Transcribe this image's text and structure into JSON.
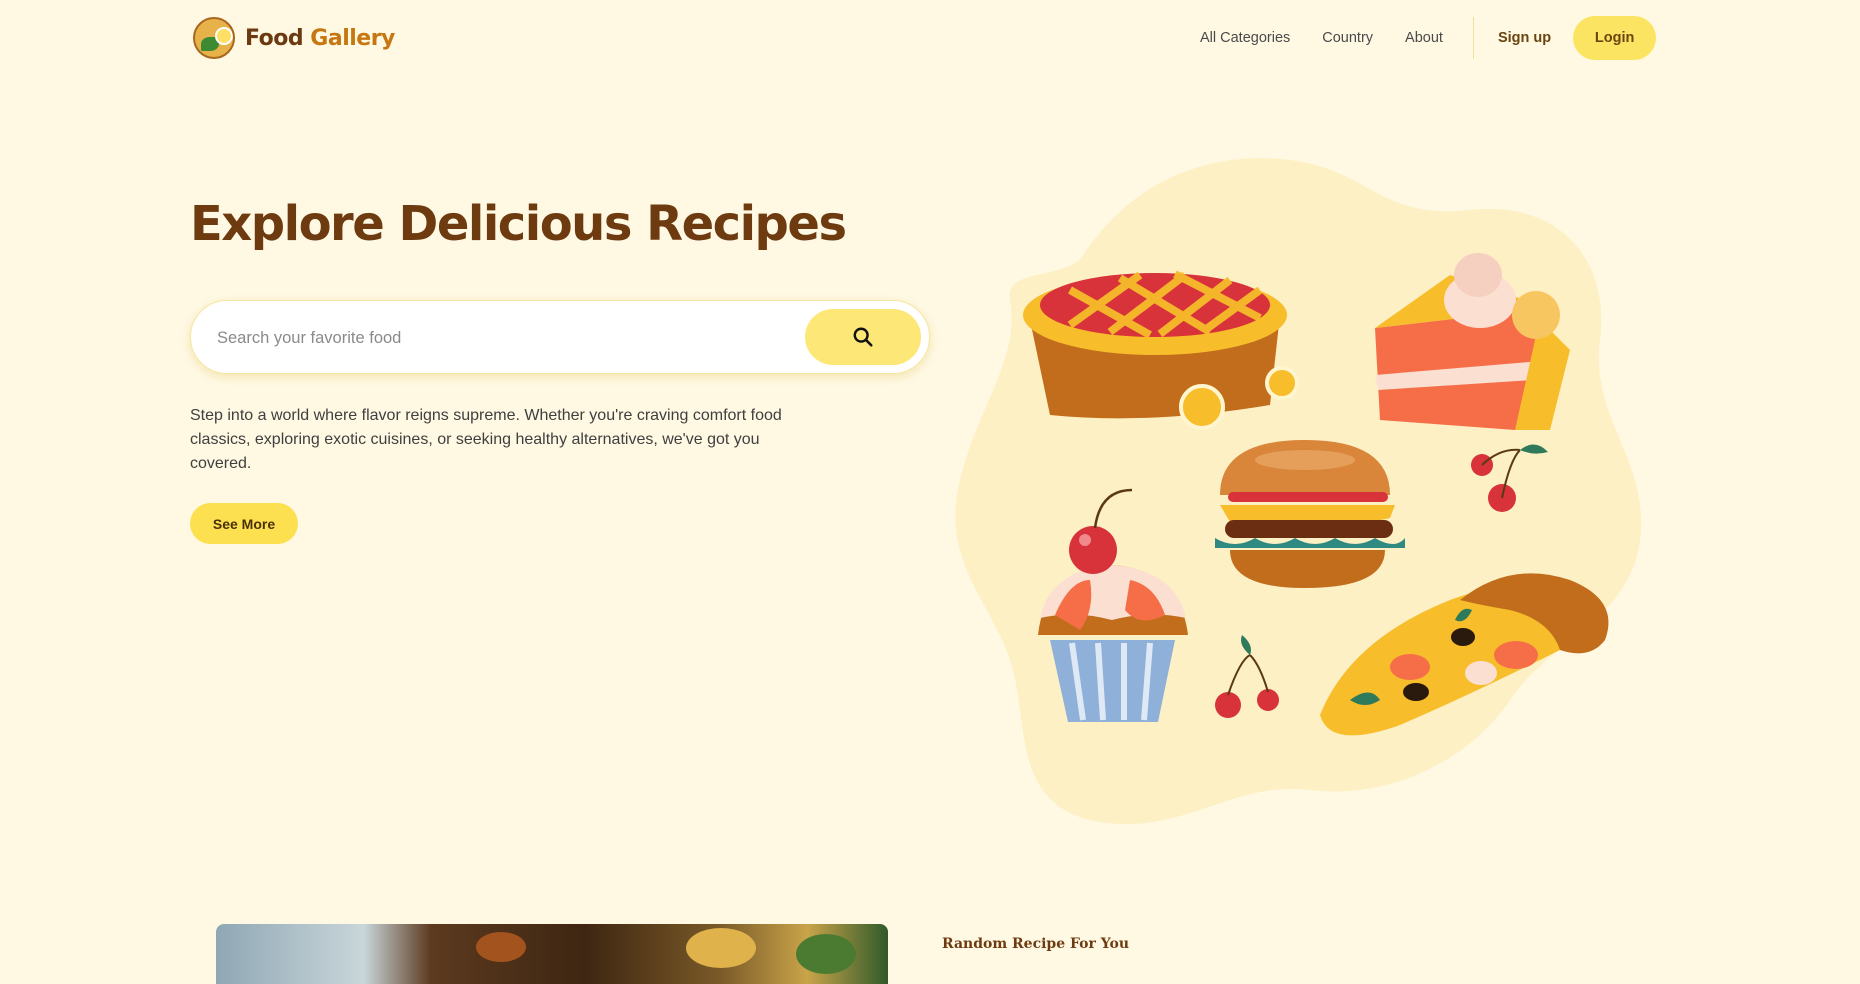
{
  "brand": {
    "name_part1": "Food",
    "name_part2": "Gallery"
  },
  "nav": {
    "links": [
      "All Categories",
      "Country",
      "About"
    ],
    "signup_label": "Sign up",
    "login_label": "Login"
  },
  "hero": {
    "title": "Explore Delicious Recipes",
    "search_placeholder": "Search your favorite food",
    "description": "Step into a world where flavor reigns supreme. Whether you're craving comfort food classics, exploring exotic cuisines, or seeking healthy alternatives, we've got you covered.",
    "cta_label": "See More"
  },
  "random_section": {
    "label": "Random Recipe For You"
  },
  "icons": {
    "logo": "food-gallery-logo-icon",
    "search": "search-icon",
    "illustration": [
      "pie",
      "cake-slice",
      "burger",
      "cupcake",
      "cherries",
      "pizza-slice"
    ]
  },
  "colors": {
    "background": "#fff9e4",
    "accent_yellow": "#fde04f",
    "title_brown": "#6e3b10",
    "blob": "#fdf0c4"
  }
}
